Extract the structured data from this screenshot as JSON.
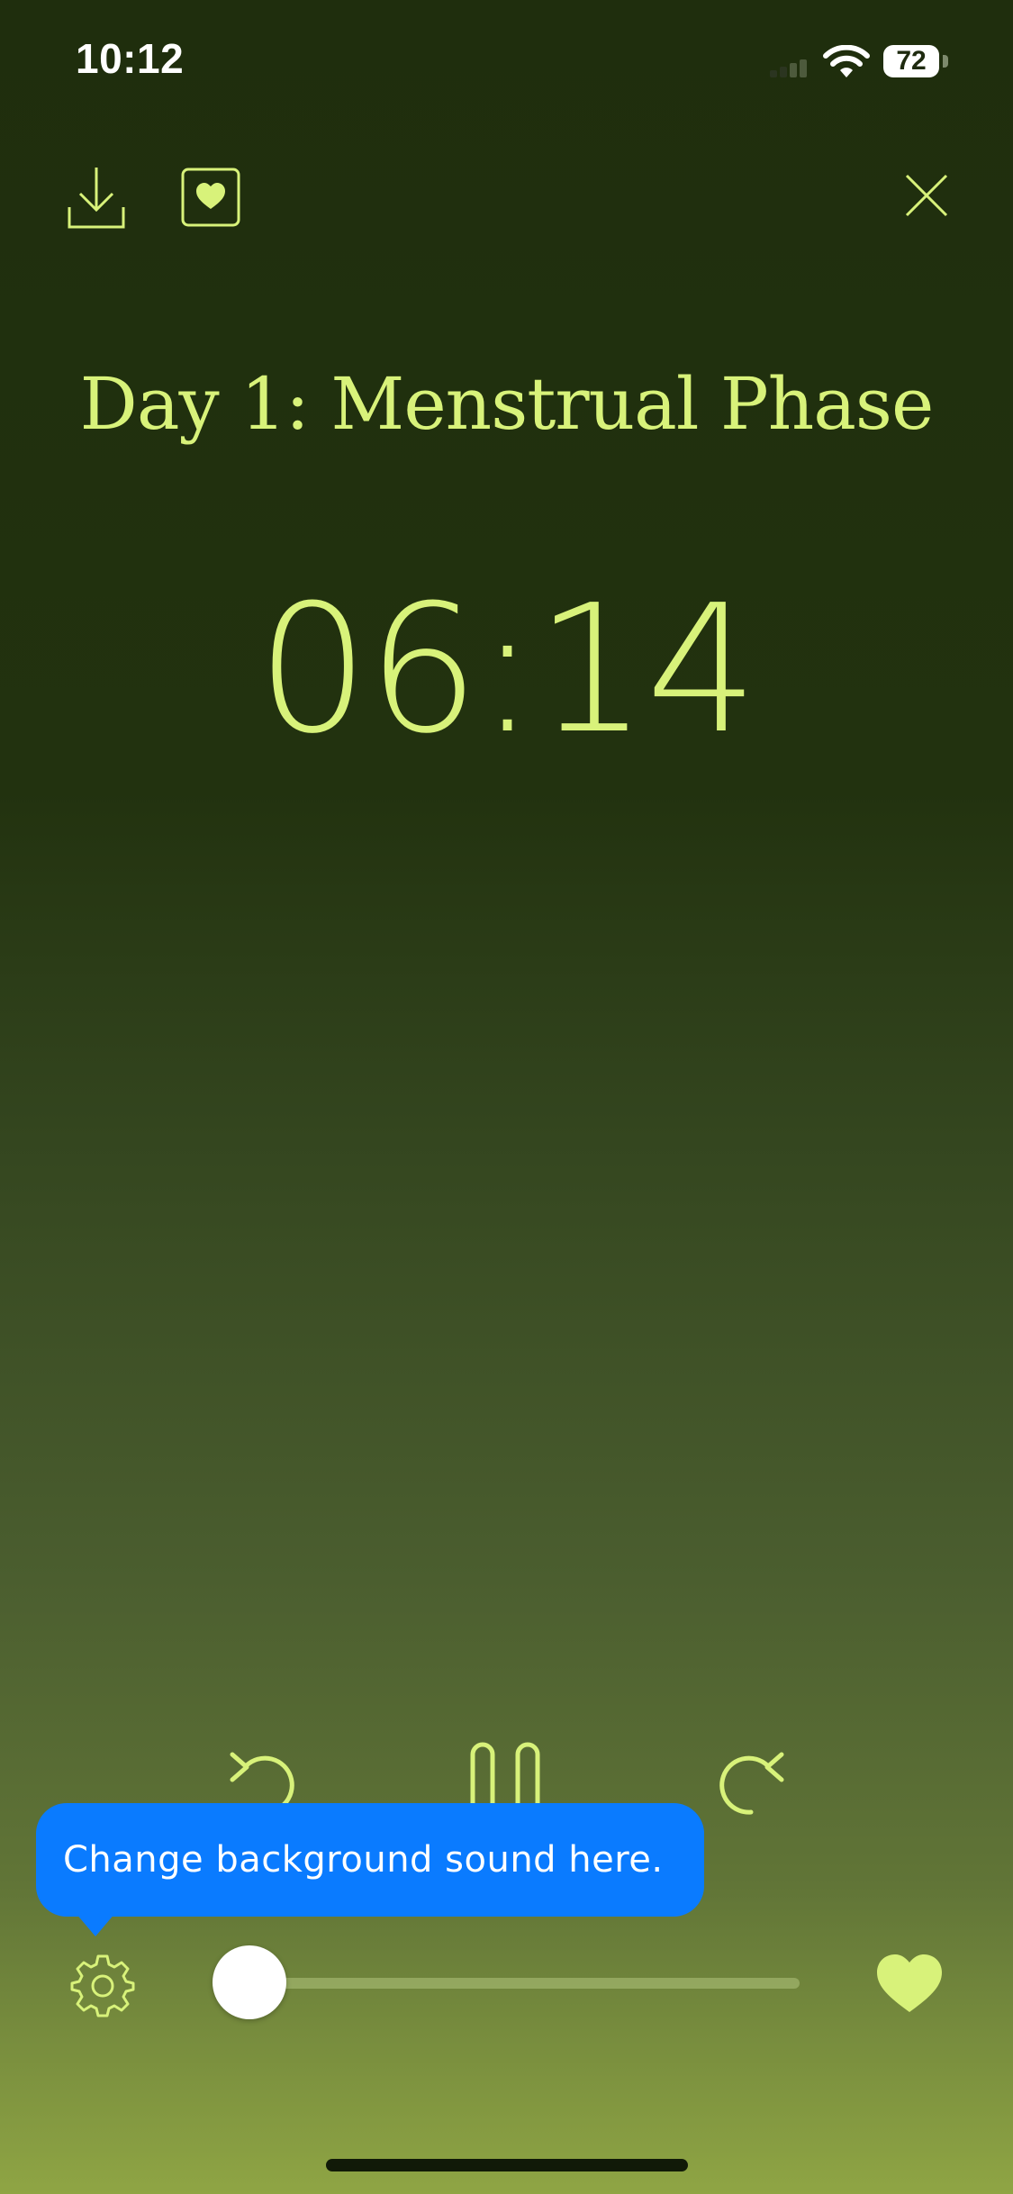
{
  "status_bar": {
    "time": "10:12",
    "battery": "72",
    "icons": [
      "signal-icon",
      "wifi-icon",
      "battery-icon"
    ]
  },
  "toolbar": {
    "icons": [
      "download-icon",
      "favorite-box-icon",
      "close-icon"
    ]
  },
  "session": {
    "title": "Day 1: Menstrual Phase",
    "time_remaining": "06:14"
  },
  "controls": {
    "icons": [
      "rewind-icon",
      "pause-icon",
      "forward-icon"
    ]
  },
  "tooltip": {
    "text": "Change background sound here."
  },
  "bottom_bar": {
    "icons": [
      "settings-gear-icon",
      "heart-icon"
    ],
    "progress": 0.0
  },
  "colors": {
    "accent": "#d8f27a",
    "tooltip_bg": "#0a7bff",
    "bg_top": "#1f2e0d",
    "bg_bottom": "#8fa544"
  }
}
